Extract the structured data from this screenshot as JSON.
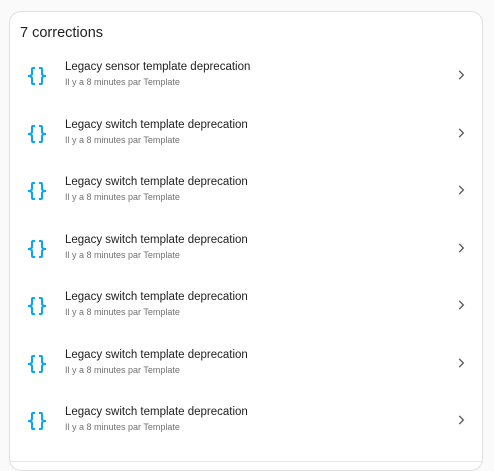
{
  "card": {
    "title": "7 corrections"
  },
  "items": [
    {
      "icon": "curly-braces-icon",
      "title": "Legacy sensor template deprecation",
      "subtitle": "Il y a 8 minutes par Template"
    },
    {
      "icon": "curly-braces-icon",
      "title": "Legacy switch template deprecation",
      "subtitle": "Il y a 8 minutes par Template"
    },
    {
      "icon": "curly-braces-icon",
      "title": "Legacy switch template deprecation",
      "subtitle": "Il y a 8 minutes par Template"
    },
    {
      "icon": "curly-braces-icon",
      "title": "Legacy switch template deprecation",
      "subtitle": "Il y a 8 minutes par Template"
    },
    {
      "icon": "curly-braces-icon",
      "title": "Legacy switch template deprecation",
      "subtitle": "Il y a 8 minutes par Template"
    },
    {
      "icon": "curly-braces-icon",
      "title": "Legacy switch template deprecation",
      "subtitle": "Il y a 8 minutes par Template"
    },
    {
      "icon": "curly-braces-icon",
      "title": "Legacy switch template deprecation",
      "subtitle": "Il y a 8 minutes par Template"
    }
  ],
  "colors": {
    "icon": "#03a9f4",
    "chevron": "#616161"
  }
}
